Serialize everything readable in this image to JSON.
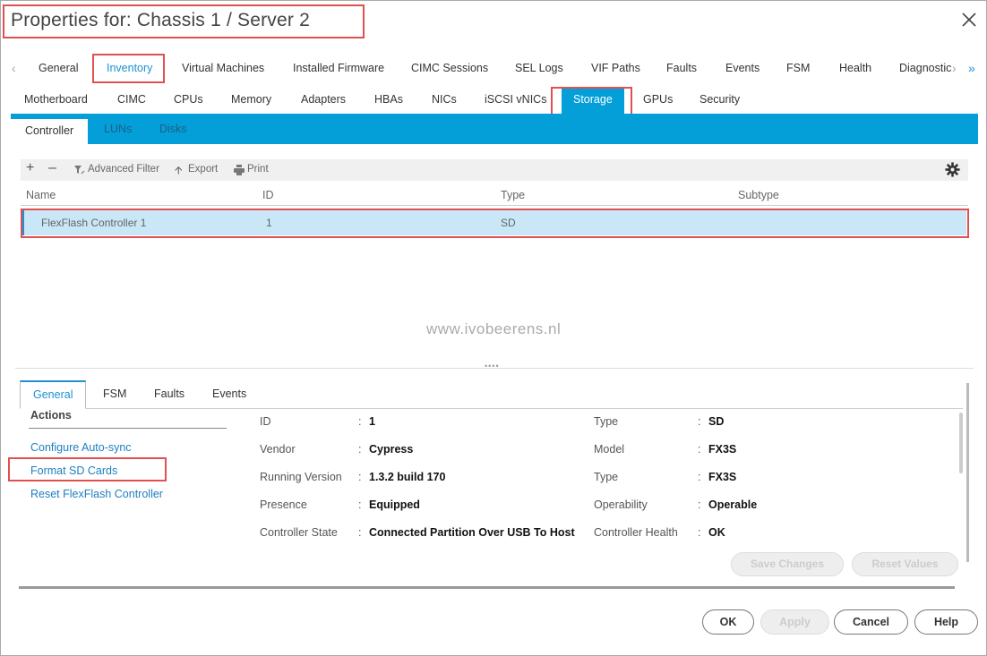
{
  "dialog": {
    "title": "Properties for: Chassis 1 / Server 2"
  },
  "tabs_main": [
    "General",
    "Inventory",
    "Virtual Machines",
    "Installed Firmware",
    "CIMC Sessions",
    "SEL Logs",
    "VIF Paths",
    "Faults",
    "Events",
    "FSM",
    "Health",
    "Diagnostic"
  ],
  "tabs_inventory": [
    "Motherboard",
    "CIMC",
    "CPUs",
    "Memory",
    "Adapters",
    "HBAs",
    "NICs",
    "iSCSI vNICs",
    "Storage",
    "GPUs",
    "Security"
  ],
  "tabs_storage": [
    "Controller",
    "LUNs",
    "Disks"
  ],
  "toolbar": {
    "advanced_filter": "Advanced Filter",
    "export": "Export",
    "print": "Print"
  },
  "table": {
    "headers": [
      "Name",
      "ID",
      "Type",
      "Subtype"
    ],
    "rows": [
      {
        "name": "FlexFlash Controller 1",
        "id": "1",
        "type": "SD",
        "subtype": ""
      }
    ]
  },
  "watermark": "www.ivobeerens.nl",
  "detail_tabs": [
    "General",
    "FSM",
    "Faults",
    "Events"
  ],
  "actions": {
    "heading": "Actions",
    "links": [
      "Configure Auto-sync",
      "Format SD Cards",
      "Reset FlexFlash Controller"
    ]
  },
  "properties_left": [
    {
      "label": "ID",
      "value": "1"
    },
    {
      "label": "Vendor",
      "value": "Cypress"
    },
    {
      "label": "Running Version",
      "value": "1.3.2 build 170"
    },
    {
      "label": "Presence",
      "value": "Equipped"
    },
    {
      "label": "Controller State",
      "value": "Connected Partition Over USB To Host"
    }
  ],
  "properties_right": [
    {
      "label": "Type",
      "value": "SD"
    },
    {
      "label": "Model",
      "value": "FX3S"
    },
    {
      "label": "Type",
      "value": "FX3S"
    },
    {
      "label": "Operability",
      "value": "Operable"
    },
    {
      "label": "Controller Health",
      "value": "OK"
    }
  ],
  "panel_buttons": {
    "save": "Save Changes",
    "reset": "Reset Values"
  },
  "footer_buttons": {
    "ok": "OK",
    "apply": "Apply",
    "cancel": "Cancel",
    "help": "Help"
  },
  "colors": {
    "accent": "#049fd9",
    "link": "#1e7fc0",
    "highlight": "#e05050",
    "selected_row": "#c9e7f6"
  }
}
